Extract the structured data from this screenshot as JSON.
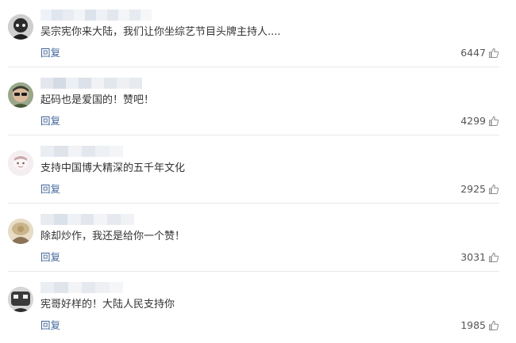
{
  "comments": [
    {
      "text": "吴宗宪你来大陆，我们让你坐综艺节目头牌主持人....",
      "reply_label": "回复",
      "likes": "6447",
      "avatar_icon": "avatar-dark-icon",
      "avatar_color": "#2b2b2b"
    },
    {
      "text": "起码也是爱国的！赞吧！",
      "reply_label": "回复",
      "likes": "4299",
      "avatar_icon": "avatar-sunglasses-icon",
      "avatar_color": "#6b7a5a"
    },
    {
      "text": "支持中国博大精深的五千年文化",
      "reply_label": "回复",
      "likes": "2925",
      "avatar_icon": "avatar-light-icon",
      "avatar_color": "#f1e9ea"
    },
    {
      "text": "除却炒作，我还是给你一个赞！",
      "reply_label": "回复",
      "likes": "3031",
      "avatar_icon": "avatar-tan-icon",
      "avatar_color": "#c9b48c"
    },
    {
      "text": "宪哥好样的！大陆人民支持你",
      "reply_label": "回复",
      "likes": "1985",
      "avatar_icon": "avatar-dark-icon",
      "avatar_color": "#3a3a3a"
    }
  ],
  "colors": {
    "reply_link": "#406599",
    "text": "#333333",
    "divider": "#e8e8e8"
  }
}
